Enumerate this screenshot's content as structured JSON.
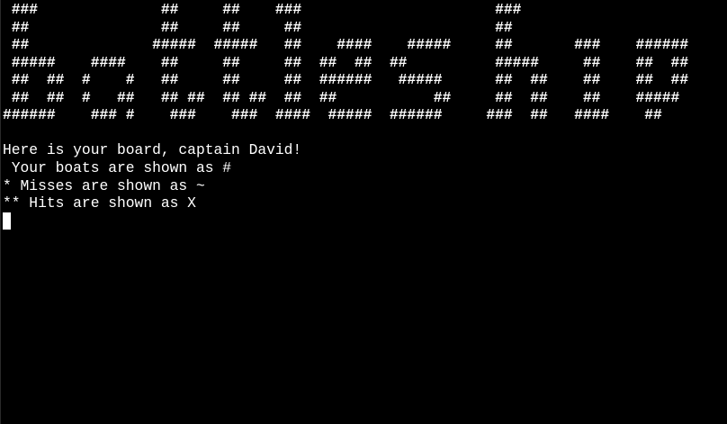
{
  "terminal": {
    "banner_lines": [
      " ###              ##     ##    ###                      ###",
      " ##               ##     ##     ##                      ##",
      " ##              #####  #####   ##    ####    #####     ##       ###    ######",
      " #####    ####    ##     ##     ##  ##  ##  ##          #####     ##    ##  ##",
      " ##  ##  #    #   ##     ##     ##  ######   #####      ##  ##    ##    ##  ##",
      " ##  ##  #   ##   ## ##  ## ##  ##  ##           ##     ##  ##    ##    #####",
      "######    ### #    ###    ###  ####  #####  ######     ###  ##   ####    ##"
    ],
    "messages": {
      "line1": "Here is your board, captain David!",
      "line2": " Your boats are shown as #",
      "line3": "* Misses are shown as ~",
      "line4": "** Hits are shown as X"
    },
    "colors": {
      "background": "#000000",
      "foreground": "#ffffff"
    }
  }
}
